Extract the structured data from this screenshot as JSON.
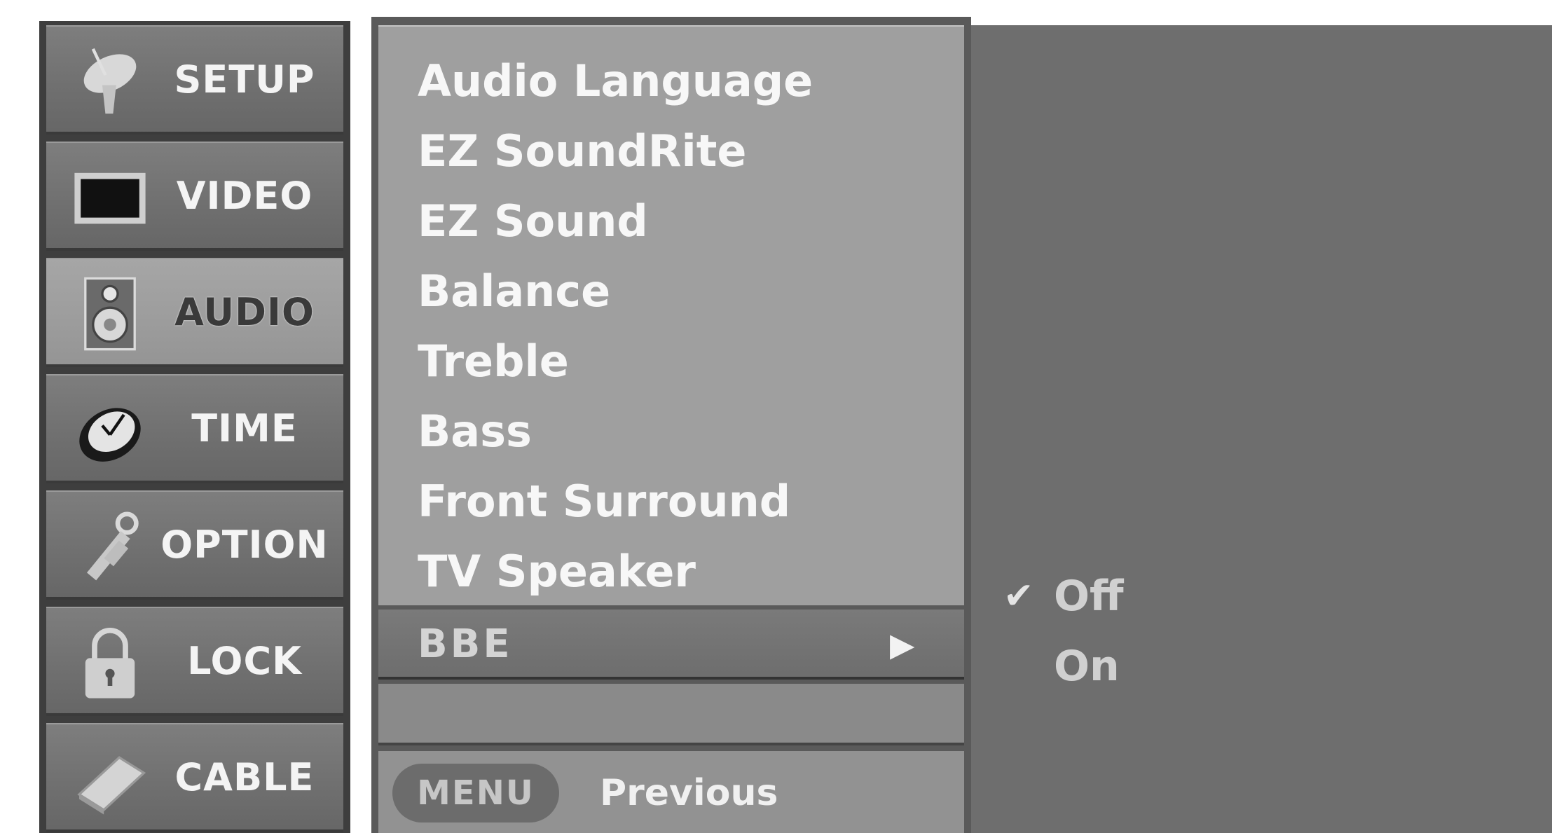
{
  "sidebar": {
    "items": [
      {
        "label": "SETUP",
        "icon": "satellite-dish-icon"
      },
      {
        "label": "VIDEO",
        "icon": "tv-screen-icon"
      },
      {
        "label": "AUDIO",
        "icon": "speaker-icon",
        "active": true
      },
      {
        "label": "TIME",
        "icon": "clock-icon"
      },
      {
        "label": "OPTION",
        "icon": "wrench-tag-icon"
      },
      {
        "label": "LOCK",
        "icon": "padlock-icon"
      },
      {
        "label": "CABLE",
        "icon": "cable-box-icon"
      }
    ]
  },
  "submenu": {
    "items": [
      "Audio Language",
      "EZ SoundRite",
      "EZ Sound",
      "Balance",
      "Treble",
      "Bass",
      "Front Surround",
      "TV Speaker"
    ],
    "selected": {
      "label": "BBE",
      "arrow": "▶"
    }
  },
  "options": {
    "items": [
      {
        "label": "Off",
        "checked": true,
        "check_glyph": "✔"
      },
      {
        "label": "On",
        "checked": false
      }
    ]
  },
  "footer": {
    "button_label": "MENU",
    "hint": "Previous"
  }
}
